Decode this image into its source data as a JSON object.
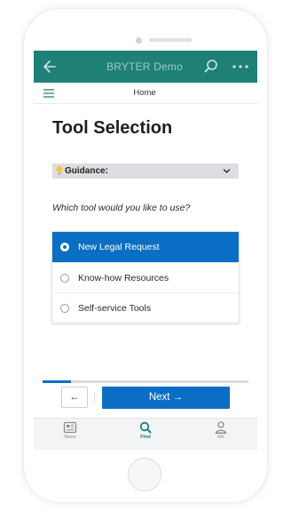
{
  "appbar": {
    "title": "BRYTER Demo"
  },
  "subnav": {
    "home_label": "Home"
  },
  "page": {
    "title": "Tool Selection",
    "guidance_label": "Guidance:",
    "question": "Which tool would you like to use?"
  },
  "options": [
    {
      "label": "New Legal Request",
      "selected": true
    },
    {
      "label": "Know-how Resources",
      "selected": false
    },
    {
      "label": "Self-service Tools",
      "selected": false
    }
  ],
  "progress": {
    "fraction": 0.14
  },
  "nav": {
    "prev_label": "←",
    "next_label": "Next →"
  },
  "tabbar": {
    "items": [
      {
        "label": "News",
        "icon": "news-icon",
        "active": false
      },
      {
        "label": "Find",
        "icon": "search-icon",
        "active": true
      },
      {
        "label": "Me",
        "icon": "user-icon",
        "active": false
      }
    ]
  },
  "colors": {
    "brand": "#1f8078",
    "accent": "#0a6ec4",
    "guidance_bg": "#dcdee2"
  }
}
